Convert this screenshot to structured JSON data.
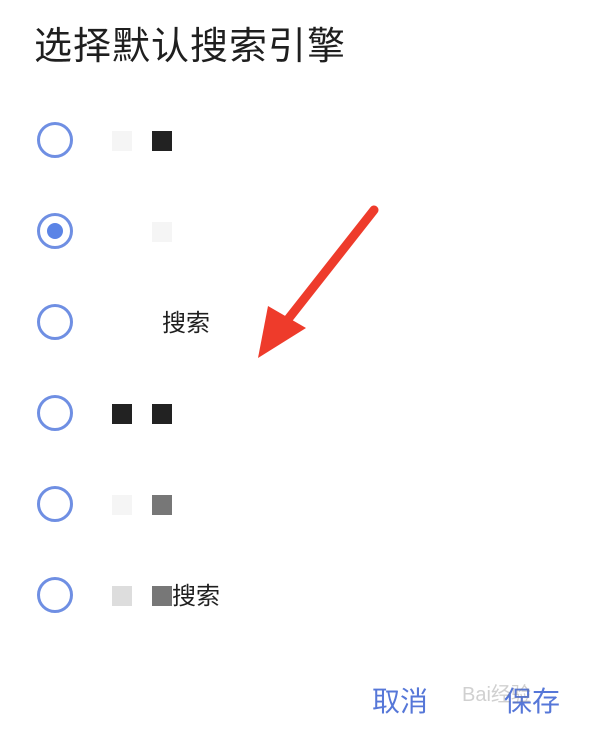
{
  "dialog": {
    "title": "选择默认搜索引擎"
  },
  "options": [
    {
      "label": "",
      "checked": false
    },
    {
      "label": "",
      "checked": true
    },
    {
      "label": "搜索",
      "checked": false
    },
    {
      "label": "",
      "checked": false
    },
    {
      "label": "",
      "checked": false
    },
    {
      "label": "搜索",
      "checked": false
    }
  ],
  "footer": {
    "cancel_label": "取消",
    "save_label": "保存"
  },
  "colors": {
    "accent": "#5b84e6",
    "radio_border": "#6f8fe3",
    "annotation_arrow": "#ee3b2b"
  },
  "watermark": {
    "text": "Bai经验"
  }
}
